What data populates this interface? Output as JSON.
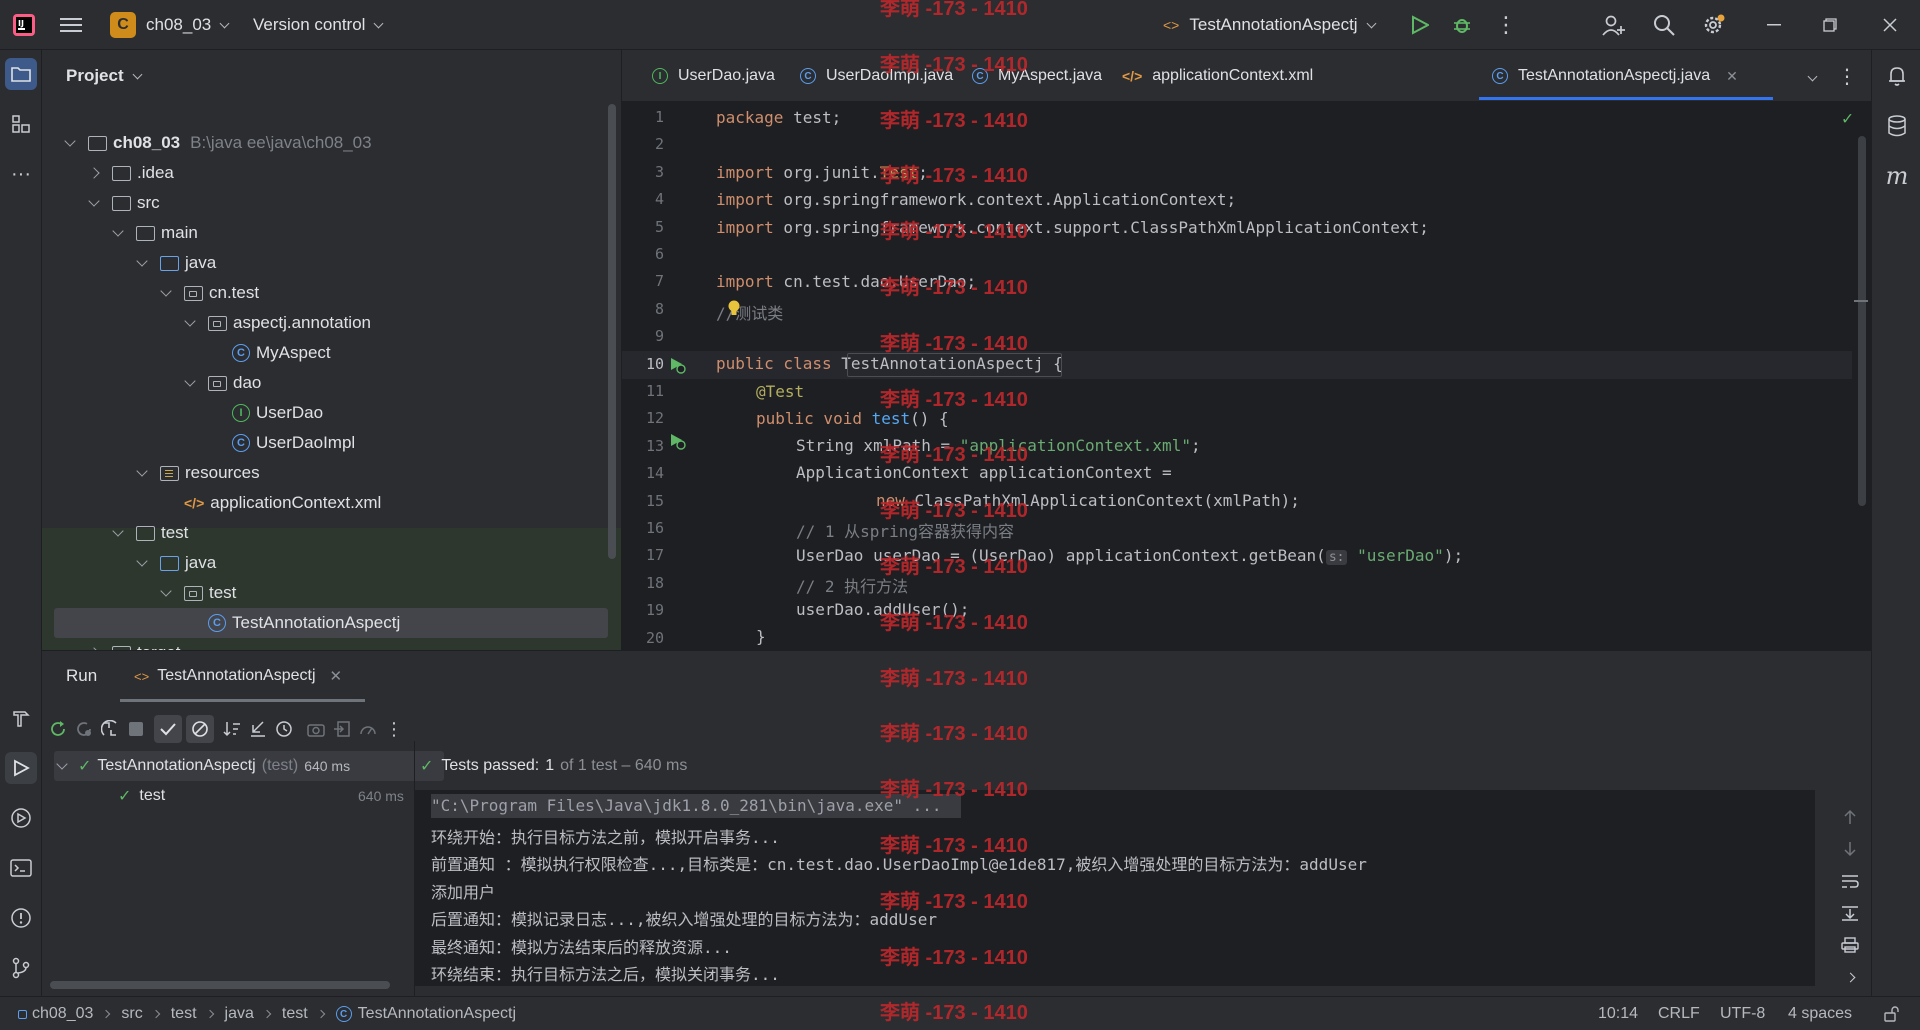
{
  "titlebar": {
    "project_badge": "C",
    "project_name": "ch08_03",
    "vcs_label": "Version control",
    "run_config": "TestAnnotationAspectj"
  },
  "project_panel": {
    "title": "Project",
    "tree": [
      {
        "label": "ch08_03",
        "extra": "B:\\java ee\\java\\ch08_03",
        "depth": 0,
        "type": "module",
        "state": "open"
      },
      {
        "label": ".idea",
        "depth": 1,
        "type": "folder",
        "state": "closed"
      },
      {
        "label": "src",
        "depth": 1,
        "type": "folder",
        "state": "open"
      },
      {
        "label": "main",
        "depth": 2,
        "type": "folder",
        "state": "open"
      },
      {
        "label": "java",
        "depth": 3,
        "type": "src",
        "state": "open"
      },
      {
        "label": "cn.test",
        "depth": 4,
        "type": "pkg",
        "state": "open"
      },
      {
        "label": "aspectj.annotation",
        "depth": 5,
        "type": "pkg",
        "state": "open"
      },
      {
        "label": "MyAspect",
        "depth": 6,
        "type": "class"
      },
      {
        "label": "dao",
        "depth": 5,
        "type": "pkg",
        "state": "open"
      },
      {
        "label": "UserDao",
        "depth": 6,
        "type": "interface"
      },
      {
        "label": "UserDaoImpl",
        "depth": 6,
        "type": "class"
      },
      {
        "label": "resources",
        "depth": 3,
        "type": "res",
        "state": "open"
      },
      {
        "label": "applicationContext.xml",
        "depth": 4,
        "type": "xml"
      },
      {
        "label": "test",
        "depth": 2,
        "type": "folder",
        "state": "open"
      },
      {
        "label": "java",
        "depth": 3,
        "type": "src",
        "state": "open"
      },
      {
        "label": "test",
        "depth": 4,
        "type": "pkg",
        "state": "open"
      },
      {
        "label": "TestAnnotationAspectj",
        "depth": 5,
        "type": "class",
        "selected": true
      },
      {
        "label": "target",
        "depth": 1,
        "type": "folder",
        "state": "closed"
      }
    ]
  },
  "editor": {
    "tabs": [
      {
        "label": "UserDao.java",
        "icon": "I"
      },
      {
        "label": "UserDaoImpl.java",
        "icon": "C"
      },
      {
        "label": "MyAspect.java",
        "icon": "C"
      },
      {
        "label": "applicationContext.xml",
        "icon": "xml"
      },
      {
        "label": "TestAnnotationAspectj.java",
        "icon": "C",
        "active": true
      }
    ],
    "line_numbers": [
      "1",
      "2",
      "3",
      "4",
      "5",
      "6",
      "7",
      "8",
      "9",
      "10",
      "11",
      "12",
      "13",
      "14",
      "15",
      "16",
      "17",
      "18",
      "19",
      "20"
    ]
  },
  "code": {
    "l1_kw": "package",
    "l1_rest": " test;",
    "l4_kw": "import",
    "l4_rest": " org.junit.",
    "l4_cls": "Test",
    "l4_end": ";",
    "l5_kw": "import",
    "l5_rest": " org.springframework.context.ApplicationContext;",
    "l6_kw": "import",
    "l6_rest": " org.springframework.context.support.ClassPathXmlApplicationContext;",
    "l8_kw": "import",
    "l8_rest": " cn.test.dao.UserDao;",
    "l9_cmt": "//测试类",
    "l10_kw": "public class",
    "l10_rest": " TestAnnotationAspectj {",
    "l11_ann": "@Test",
    "l12_kw": "public void",
    "l12_fn": " test",
    "l12_rest": "() {",
    "l13_rest": "String xmlPath = ",
    "l13_str": "\"applicationContext.xml\"",
    "l13_end": ";",
    "l14_rest": "ApplicationContext applicationContext =",
    "l15_kw": "new",
    "l15_rest": " ClassPathXmlApplicationContext(xmlPath);",
    "l16_cmt": "// 1 从spring容器获得内容",
    "l17_rest": "UserDao userDao = (UserDao) applicationContext.getBean(",
    "l17_hint": "s:",
    "l17_str": "\"userDao\"",
    "l17_end": ");",
    "l18_cmt": "// 2 执行方法",
    "l19_rest": "userDao.addUser();",
    "l20_rest": "}"
  },
  "run": {
    "title": "Run",
    "tab_label": "TestAnnotationAspectj",
    "tree_root": "TestAnnotationAspectj",
    "tree_root_extra": "(test)",
    "tree_root_time": "640 ms",
    "tree_child": "test",
    "tree_child_time": "640 ms",
    "status_prefix": "Tests passed:",
    "status_count": "1",
    "status_suffix": "of 1 test – 640 ms",
    "console": [
      "\"C:\\Program Files\\Java\\jdk1.8.0_281\\bin\\java.exe\" ...",
      "环绕开始：执行目标方法之前，模拟开启事务...",
      "前置通知 ：模拟执行权限检查...,目标类是：cn.test.dao.UserDaoImpl@e1de817,被织入增强处理的目标方法为：addUser",
      "添加用户",
      "后置通知：模拟记录日志...,被织入增强处理的目标方法为：addUser",
      "最终通知：模拟方法结束后的释放资源...",
      "环绕结束：执行目标方法之后，模拟关闭事务..."
    ]
  },
  "statusbar": {
    "breadcrumb": [
      "ch08_03",
      "src",
      "test",
      "java",
      "test",
      "TestAnnotationAspectj"
    ],
    "position": "10:14",
    "line_sep": "CRLF",
    "encoding": "UTF-8",
    "indent": "4 spaces"
  },
  "watermark": "李萌 -173 - 1410"
}
